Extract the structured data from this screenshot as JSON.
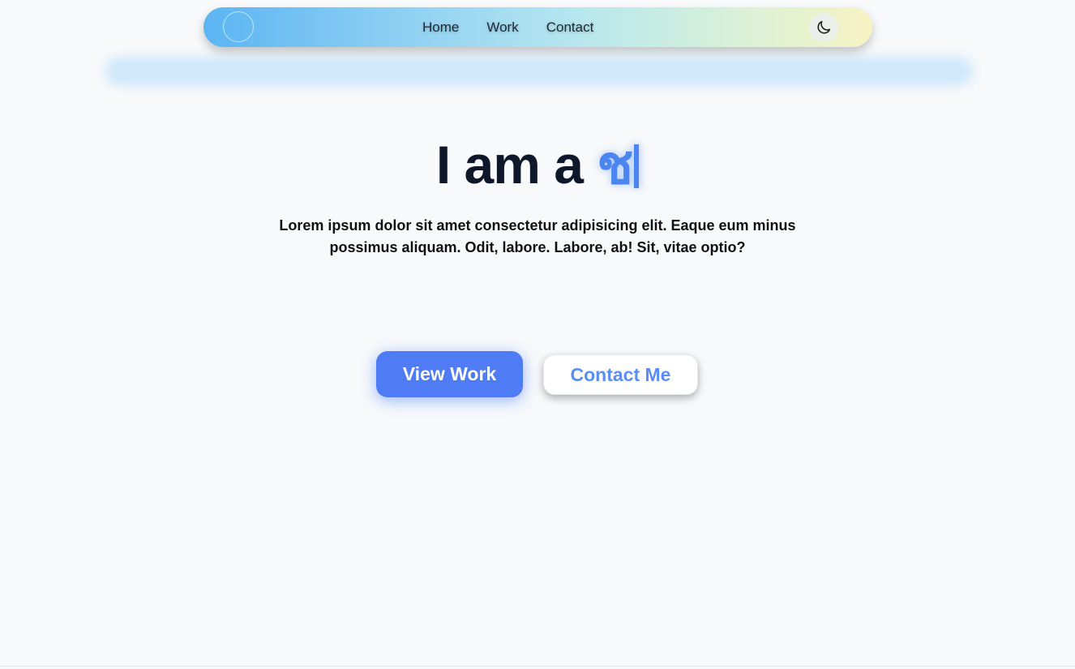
{
  "nav": {
    "links": [
      "Home",
      "Work",
      "Contact"
    ],
    "theme_icon": "moon-icon",
    "gradient": [
      "#5bb5f3",
      "#b5e6ef",
      "#f6f3c3"
    ]
  },
  "hero": {
    "title_prefix": "I am a ",
    "typed_text": "ช",
    "description": "Lorem ipsum dolor sit amet consectetur adipisicing elit. Eaque eum minus possimus aliquam. Odit, labore. Labore, ab! Sit, vitae optio?"
  },
  "buttons": {
    "primary_label": "View Work",
    "secondary_label": "Contact Me"
  },
  "colors": {
    "accent": "#4f7cf5",
    "typed": "#4b86f0",
    "background": "#f7f9fb"
  }
}
